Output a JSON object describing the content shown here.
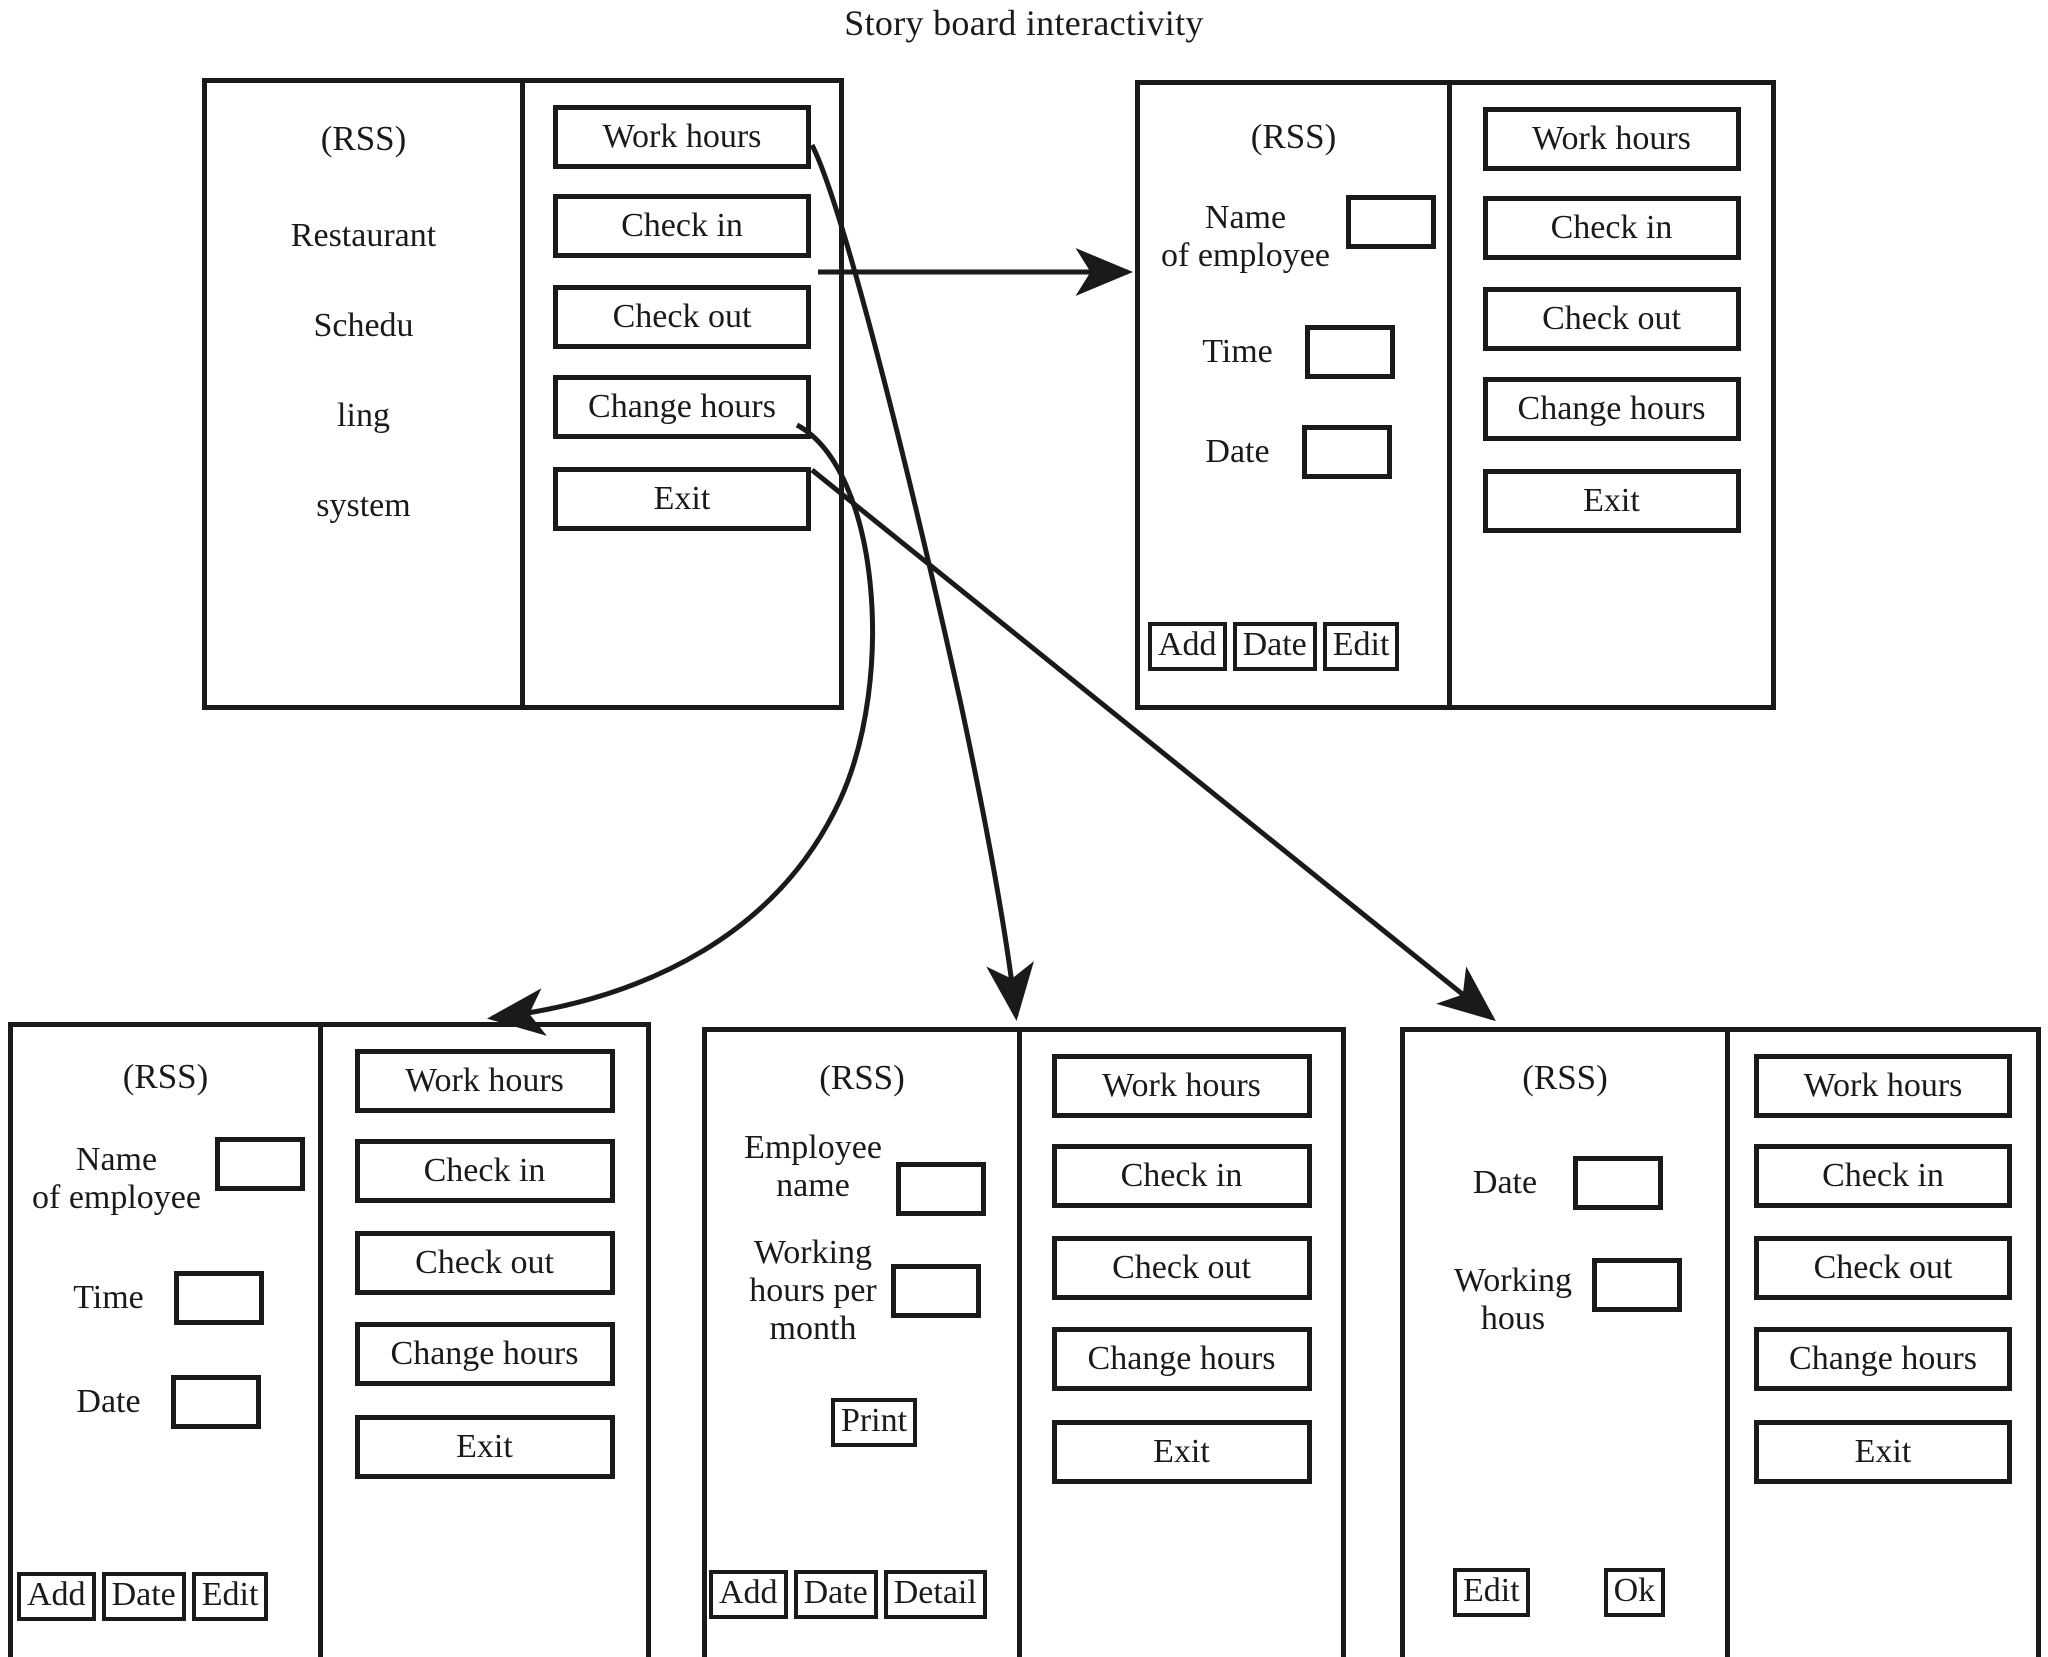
{
  "title": "Story board interactivity",
  "screens": [
    {
      "id": "main-menu",
      "heading": "(RSS)",
      "description_lines": [
        "Restaurant",
        "Schedu",
        "ling",
        "system"
      ],
      "menu": [
        "Work hours",
        "Check in",
        "Check out",
        "Change hours",
        "Exit"
      ]
    },
    {
      "id": "check-in",
      "heading": "(RSS)",
      "fields": [
        {
          "label": "Name\nof employee",
          "value": ""
        },
        {
          "label": "Time",
          "value": ""
        },
        {
          "label": "Date",
          "value": ""
        }
      ],
      "actions": [
        "Add",
        "Date",
        "Edit"
      ],
      "menu": [
        "Work hours",
        "Check in",
        "Check out",
        "Change hours",
        "Exit"
      ]
    },
    {
      "id": "check-out",
      "heading": "(RSS)",
      "fields": [
        {
          "label": "Name\nof employee",
          "value": ""
        },
        {
          "label": "Time",
          "value": ""
        },
        {
          "label": "Date",
          "value": ""
        }
      ],
      "actions": [
        "Add",
        "Date",
        "Edit"
      ],
      "menu": [
        "Work hours",
        "Check in",
        "Check out",
        "Change hours",
        "Exit"
      ]
    },
    {
      "id": "work-hours",
      "heading": "(RSS)",
      "fields": [
        {
          "label": "Employee\nname",
          "value": ""
        },
        {
          "label": "Working\nhours per\nmonth",
          "value": ""
        }
      ],
      "print_action": "Print",
      "actions": [
        "Add",
        "Date",
        "Detail"
      ],
      "menu": [
        "Work hours",
        "Check in",
        "Check out",
        "Change hours",
        "Exit"
      ]
    },
    {
      "id": "change-hours",
      "heading": "(RSS)",
      "fields": [
        {
          "label": "Date",
          "value": ""
        },
        {
          "label": "Working\nhous",
          "value": ""
        }
      ],
      "actions": [
        "Edit",
        "Ok"
      ],
      "menu": [
        "Work hours",
        "Check in",
        "Check out",
        "Change hours",
        "Exit"
      ]
    }
  ],
  "connectors": [
    {
      "from": "main-menu.Check in",
      "to": "check-in",
      "style": "straight"
    },
    {
      "from": "main-menu.Check out",
      "to": "check-out",
      "style": "curve"
    },
    {
      "from": "main-menu.Work hours",
      "to": "work-hours",
      "style": "curve"
    },
    {
      "from": "main-menu.Change hours",
      "to": "change-hours",
      "style": "straight"
    }
  ],
  "colors": {
    "stroke": "#1a1a1a",
    "background": "#ffffff"
  }
}
